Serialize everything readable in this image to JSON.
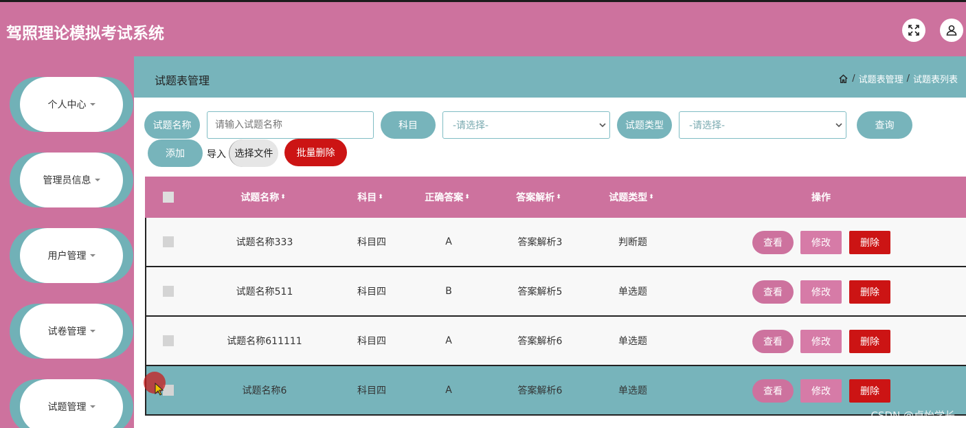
{
  "app": {
    "title": "驾照理论模拟考试系统"
  },
  "header_icons": [
    "fullscreen-icon",
    "user-icon"
  ],
  "sidebar": {
    "items": [
      {
        "label": "个人中心"
      },
      {
        "label": "管理员信息"
      },
      {
        "label": "用户管理"
      },
      {
        "label": "试卷管理"
      },
      {
        "label": "试题管理"
      }
    ]
  },
  "page": {
    "title": "试题表管理",
    "breadcrumb": [
      "试题表管理",
      "试题表列表"
    ],
    "breadcrumb_sep": "/"
  },
  "filters": {
    "name_label": "试题名称",
    "name_placeholder": "请输入试题名称",
    "subject_label": "科目",
    "subject_value": "-请选择-",
    "type_label": "试题类型",
    "type_value": "-请选择-",
    "query_label": "查询"
  },
  "toolbar": {
    "add_label": "添加",
    "import_label": "导入",
    "file_label": "选择文件",
    "batch_delete_label": "批量删除"
  },
  "table": {
    "columns": [
      "试题名称",
      "科目",
      "正确答案",
      "答案解析",
      "试题类型",
      "操作"
    ],
    "sort_glyph": "⬍",
    "rows": [
      {
        "name": "试题名称333",
        "subject": "科目四",
        "answer": "A",
        "analysis": "答案解析3",
        "type": "判断题"
      },
      {
        "name": "试题名称511",
        "subject": "科目四",
        "answer": "B",
        "analysis": "答案解析5",
        "type": "单选题"
      },
      {
        "name": "试题名称611111",
        "subject": "科目四",
        "answer": "A",
        "analysis": "答案解析6",
        "type": "单选题"
      },
      {
        "name": "试题名称6",
        "subject": "科目四",
        "answer": "A",
        "analysis": "答案解析6",
        "type": "单选题"
      }
    ],
    "actions": {
      "view": "查看",
      "edit": "修改",
      "delete": "删除"
    }
  },
  "watermark": "CSDN @卓怡学长",
  "colors": {
    "primary": "#cd729e",
    "teal": "#77b4bb",
    "danger": "#cc1414"
  }
}
